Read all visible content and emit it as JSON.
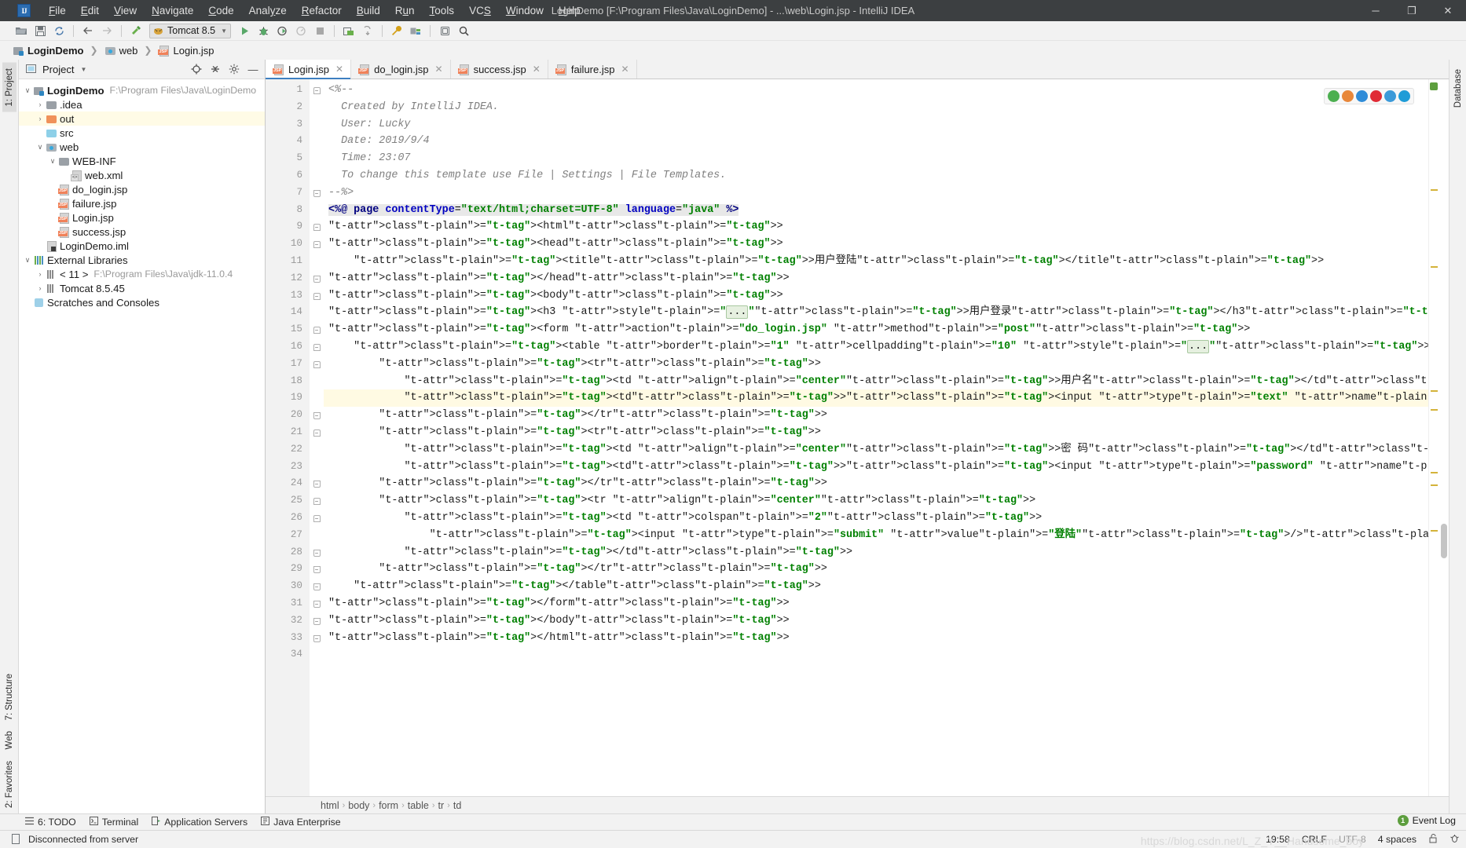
{
  "window": {
    "title": "LoginDemo [F:\\Program Files\\Java\\LoginDemo] - ...\\web\\Login.jsp - IntelliJ IDEA",
    "logo": "IJ",
    "minimize": "─",
    "maximize": "❐",
    "close": "✕"
  },
  "menu": [
    {
      "label": "File"
    },
    {
      "label": "Edit"
    },
    {
      "label": "View"
    },
    {
      "label": "Navigate"
    },
    {
      "label": "Code"
    },
    {
      "label": "Analyze"
    },
    {
      "label": "Refactor"
    },
    {
      "label": "Build"
    },
    {
      "label": "Run"
    },
    {
      "label": "Tools"
    },
    {
      "label": "VCS"
    },
    {
      "label": "Window"
    },
    {
      "label": "Help"
    }
  ],
  "toolbar": {
    "run_config": "Tomcat 8.5",
    "icons": [
      "open-folder-icon",
      "save-icon",
      "sync-icon",
      "back-arrow-icon",
      "forward-arrow-icon",
      "build-hammer-icon",
      "run-icon",
      "debug-icon",
      "run-coverage-icon",
      "profile-icon",
      "stop-icon",
      "deploy-icon",
      "update-icon",
      "settings-wrench-icon",
      "project-structure-icon",
      "toggle-bookmark-icon",
      "search-icon"
    ]
  },
  "navbar": [
    {
      "label": "LoginDemo",
      "icon": "module-icon"
    },
    {
      "label": "web",
      "icon": "web-folder-icon"
    },
    {
      "label": "Login.jsp",
      "icon": "jsp-file-icon"
    }
  ],
  "left_strip": [
    {
      "label": "1: Project",
      "active": true
    },
    {
      "label": "2: Favorites",
      "active": false
    },
    {
      "label": "Web",
      "active": false
    },
    {
      "label": "7: Structure",
      "active": false
    }
  ],
  "right_strip": [
    {
      "label": "Database"
    }
  ],
  "project_panel": {
    "title": "Project",
    "header_icons": [
      "locate-icon",
      "collapse-all-icon",
      "gear-icon",
      "hide-icon"
    ],
    "tree": [
      {
        "indent": 0,
        "arrow": "down",
        "icon": "module-icon",
        "label": "LoginDemo",
        "bold": true,
        "path": "F:\\Program Files\\Java\\LoginDemo",
        "hl": false
      },
      {
        "indent": 1,
        "arrow": "right",
        "icon": "folder-gray-icon",
        "label": ".idea",
        "bold": false,
        "path": "",
        "hl": false
      },
      {
        "indent": 1,
        "arrow": "right",
        "icon": "folder-orange-icon",
        "label": "out",
        "bold": false,
        "path": "",
        "hl": true
      },
      {
        "indent": 1,
        "arrow": "none",
        "icon": "folder-blue-icon",
        "label": "src",
        "bold": false,
        "path": "",
        "hl": false
      },
      {
        "indent": 1,
        "arrow": "down",
        "icon": "web-folder-icon",
        "label": "web",
        "bold": false,
        "path": "",
        "hl": false
      },
      {
        "indent": 2,
        "arrow": "down",
        "icon": "folder-gray-icon",
        "label": "WEB-INF",
        "bold": false,
        "path": "",
        "hl": false
      },
      {
        "indent": 3,
        "arrow": "none",
        "icon": "xml-file-icon",
        "label": "web.xml",
        "bold": false,
        "path": "",
        "hl": false
      },
      {
        "indent": 2,
        "arrow": "none",
        "icon": "jsp-file-icon",
        "label": "do_login.jsp",
        "bold": false,
        "path": "",
        "hl": false
      },
      {
        "indent": 2,
        "arrow": "none",
        "icon": "jsp-file-icon",
        "label": "failure.jsp",
        "bold": false,
        "path": "",
        "hl": false
      },
      {
        "indent": 2,
        "arrow": "none",
        "icon": "jsp-file-icon",
        "label": "Login.jsp",
        "bold": false,
        "path": "",
        "hl": false
      },
      {
        "indent": 2,
        "arrow": "none",
        "icon": "jsp-file-icon",
        "label": "success.jsp",
        "bold": false,
        "path": "",
        "hl": false
      },
      {
        "indent": 1,
        "arrow": "none",
        "icon": "iml-file-icon",
        "label": "LoginDemo.iml",
        "bold": false,
        "path": "",
        "hl": false
      },
      {
        "indent": 0,
        "arrow": "down",
        "icon": "libraries-icon",
        "label": "External Libraries",
        "bold": false,
        "path": "",
        "hl": false
      },
      {
        "indent": 1,
        "arrow": "right",
        "icon": "jdk-icon",
        "label": "< 11 >",
        "bold": false,
        "path": "F:\\Program Files\\Java\\jdk-11.0.4",
        "hl": false
      },
      {
        "indent": 1,
        "arrow": "right",
        "icon": "jdk-icon",
        "label": "Tomcat 8.5.45",
        "bold": false,
        "path": "",
        "hl": false
      },
      {
        "indent": 0,
        "arrow": "none",
        "icon": "scratches-icon",
        "label": "Scratches and Consoles",
        "bold": false,
        "path": "",
        "hl": false
      }
    ]
  },
  "editor_tabs": [
    {
      "label": "Login.jsp",
      "active": true,
      "icon": "jsp-file-icon"
    },
    {
      "label": "do_login.jsp",
      "active": false,
      "icon": "jsp-file-icon"
    },
    {
      "label": "success.jsp",
      "active": false,
      "icon": "jsp-file-icon"
    },
    {
      "label": "failure.jsp",
      "active": false,
      "icon": "jsp-file-icon"
    }
  ],
  "browser_icons": [
    {
      "name": "chrome-icon",
      "color": "#4caf50"
    },
    {
      "name": "firefox-icon",
      "color": "#e8873a"
    },
    {
      "name": "edge-icon",
      "color": "#2f8cd8"
    },
    {
      "name": "opera-icon",
      "color": "#e02a35"
    },
    {
      "name": "safari-icon",
      "color": "#3b9ad9"
    },
    {
      "name": "ie-icon",
      "color": "#1e9cd7"
    }
  ],
  "code": {
    "caret_line": 19,
    "total_lines": 34,
    "lines": [
      {
        "n": 1,
        "fold": "top",
        "text": "<%--"
      },
      {
        "n": 2,
        "fold": "",
        "text": "  Created by IntelliJ IDEA."
      },
      {
        "n": 3,
        "fold": "",
        "text": "  User: Lucky"
      },
      {
        "n": 4,
        "fold": "",
        "text": "  Date: 2019/9/4"
      },
      {
        "n": 5,
        "fold": "",
        "text": "  Time: 23:07"
      },
      {
        "n": 6,
        "fold": "",
        "text": "  To change this template use File | Settings | File Templates."
      },
      {
        "n": 7,
        "fold": "bot",
        "text": "--%>"
      },
      {
        "n": 8,
        "fold": "",
        "text": "<%@ page contentType=\"text/html;charset=UTF-8\" language=\"java\" %>"
      },
      {
        "n": 9,
        "fold": "top",
        "text": "<html>"
      },
      {
        "n": 10,
        "fold": "top",
        "text": "<head>"
      },
      {
        "n": 11,
        "fold": "",
        "text": "    <title>用户登陆</title>"
      },
      {
        "n": 12,
        "fold": "bot",
        "text": "</head>"
      },
      {
        "n": 13,
        "fold": "top",
        "text": "<body>"
      },
      {
        "n": 14,
        "fold": "",
        "text": "<h3 style=\"...\">用户登录</h3>"
      },
      {
        "n": 15,
        "fold": "top",
        "text": "<form action=\"do_login.jsp\" method=\"post\">"
      },
      {
        "n": 16,
        "fold": "top",
        "text": "    <table border=\"1\" cellpadding=\"10\" style=\"...\">"
      },
      {
        "n": 17,
        "fold": "top",
        "text": "        <tr>"
      },
      {
        "n": 18,
        "fold": "",
        "text": "            <td align=\"center\">用户名</td>"
      },
      {
        "n": 19,
        "fold": "",
        "text": "            <td><input type=\"text\" name=\"username\"/></td>"
      },
      {
        "n": 20,
        "fold": "bot",
        "text": "        </tr>"
      },
      {
        "n": 21,
        "fold": "top",
        "text": "        <tr>"
      },
      {
        "n": 22,
        "fold": "",
        "text": "            <td align=\"center\">密 码</td>"
      },
      {
        "n": 23,
        "fold": "",
        "text": "            <td><input type=\"password\" name=\"password\"/></td>"
      },
      {
        "n": 24,
        "fold": "bot",
        "text": "        </tr>"
      },
      {
        "n": 25,
        "fold": "top",
        "text": "        <tr align=\"center\">"
      },
      {
        "n": 26,
        "fold": "top",
        "text": "            <td colspan=\"2\">"
      },
      {
        "n": 27,
        "fold": "",
        "text": "                <input type=\"submit\" value=\"登陆\"/><input type=\"reset\" value=\"重置\"/>"
      },
      {
        "n": 28,
        "fold": "bot",
        "text": "            </td>"
      },
      {
        "n": 29,
        "fold": "bot",
        "text": "        </tr>"
      },
      {
        "n": 30,
        "fold": "bot",
        "text": "    </table>"
      },
      {
        "n": 31,
        "fold": "bot",
        "text": "</form>"
      },
      {
        "n": 32,
        "fold": "bot",
        "text": "</body>"
      },
      {
        "n": 33,
        "fold": "bot",
        "text": "</html>"
      },
      {
        "n": 34,
        "fold": "",
        "text": ""
      }
    ]
  },
  "breadcrumbs": [
    "html",
    "body",
    "form",
    "table",
    "tr",
    "td"
  ],
  "tool_windows": [
    {
      "label": "6: TODO",
      "icon": "todo-icon"
    },
    {
      "label": "Terminal",
      "icon": "terminal-icon"
    },
    {
      "label": "Application Servers",
      "icon": "app-servers-icon"
    },
    {
      "label": "Java Enterprise",
      "icon": "java-ee-icon"
    }
  ],
  "status": {
    "message": "Disconnected from server",
    "message_icon": "document-icon",
    "position": "19:58",
    "line_sep": "CRLF",
    "encoding": "UTF-8",
    "indent": "4 spaces",
    "lock_icon": "unlocked-icon",
    "inspection_icon": "inspections-icon",
    "event_log": "Event Log",
    "event_count": "1",
    "watermark": "https://blog.csdn.net/L_Z_Y__Handsome_boy"
  },
  "colors": {
    "accent": "#3d7fc1",
    "titlebar_bg": "#3c3f41",
    "caret_line": "#fffae3",
    "selection": "#93c8f0",
    "tag": "#000080",
    "attr": "#0000c0",
    "string": "#008000",
    "comment": "#808080"
  }
}
